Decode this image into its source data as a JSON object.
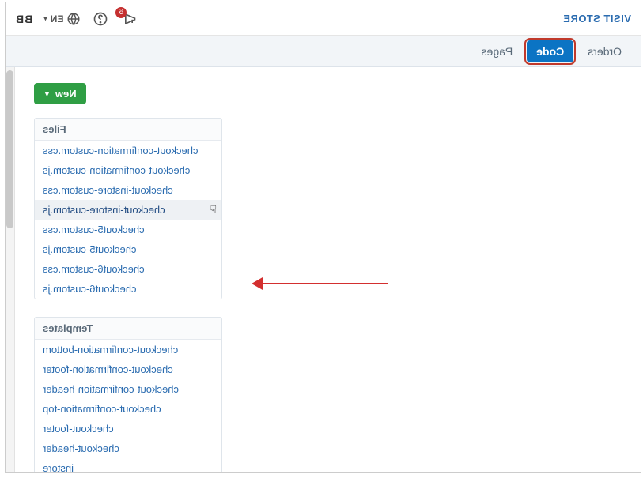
{
  "header": {
    "visit_store": "VISIT STORE",
    "notifications_count": "6",
    "language": "EN",
    "avatar": "BB"
  },
  "tabs": {
    "orders": "Orders",
    "code": "Code",
    "pages": "Pages"
  },
  "buttons": {
    "new": "New"
  },
  "files": {
    "title": "Files",
    "items": [
      "checkout-confirmation-custom.css",
      "checkout-confirmation-custom.js",
      "checkout-instore-custom.css",
      "checkout-instore-custom.js",
      "checkout5-custom.css",
      "checkout5-custom.js",
      "checkout6-custom.css",
      "checkout6-custom.js"
    ],
    "hover_index": 3
  },
  "templates": {
    "title": "Templates",
    "items": [
      "checkout-confirmation-bottom",
      "checkout-confirmation-footer",
      "checkout-confirmation-header",
      "checkout-confirmation-top",
      "checkout-footer",
      "checkout-header",
      "instore"
    ]
  }
}
